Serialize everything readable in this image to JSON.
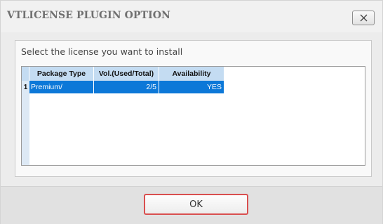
{
  "dialog": {
    "title": "VTLICENSE PLUGIN OPTION",
    "close_icon": "close-icon"
  },
  "content": {
    "prompt": "Select the license you want to install"
  },
  "table": {
    "columns": [
      "Package Type",
      "Vol.(Used/Total)",
      "Availability"
    ],
    "rows": [
      {
        "row_number": "1",
        "package_type": "Premium/",
        "volume": "2/5",
        "availability": "YES",
        "selected": true
      }
    ]
  },
  "footer": {
    "ok_label": "OK"
  },
  "colors": {
    "selection": "#0c78d8",
    "header": "#c4dcf2",
    "ok_border": "#d94f4f"
  }
}
